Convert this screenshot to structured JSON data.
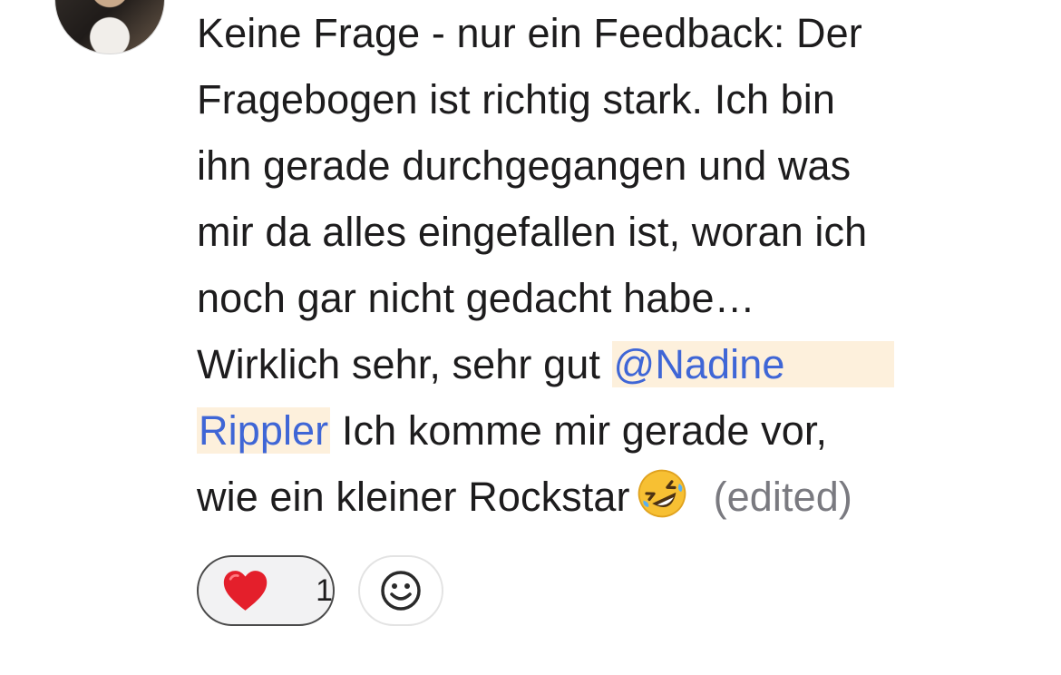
{
  "message": {
    "lines": [
      "Keine Frage - nur ein Feedback: Der",
      "Fragebogen ist richtig stark. Ich bin",
      "ihn gerade durchgegangen und was",
      "mir da alles eingefallen ist, woran ich",
      "noch gar nicht gedacht habe…"
    ],
    "line6_prefix": "Wirklich sehr, sehr gut ",
    "mention_part1": "@Nadine",
    "mention_part2": "Rippler",
    "line7_suffix": " Ich komme mir gerade vor,",
    "line8_text": "wie ein kleiner Rockstar",
    "emoji": "rolling-on-the-floor-laughing-emoji",
    "edited_label": "(edited)"
  },
  "reactions": [
    {
      "icon": "red-heart-emoji",
      "count": "1"
    }
  ],
  "add_reaction": {
    "icon": "smiley-add-reaction-icon"
  },
  "colors": {
    "mention_text": "#3f66d6",
    "mention_background": "#fdf0dc",
    "edited_text": "#7a7a80",
    "reaction_border": "#4a4a4a",
    "reaction_background": "#f2f2f3"
  }
}
